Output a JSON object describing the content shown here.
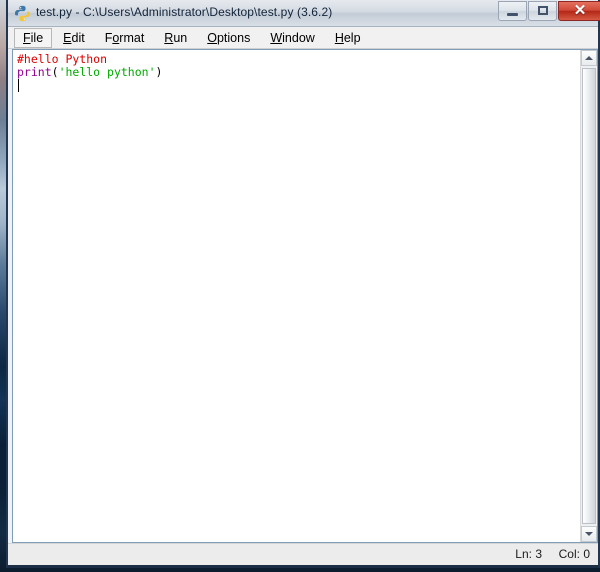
{
  "window": {
    "title": "test.py - C:\\Users\\Administrator\\Desktop\\test.py (3.6.2)",
    "icon": "python-idle-icon",
    "controls": {
      "minimize_label": "—",
      "maximize_label": "□",
      "close_label": "✕"
    }
  },
  "menubar": {
    "items": [
      {
        "label": "File",
        "pre": "",
        "accel": "F",
        "post": "ile",
        "name": "menu-file"
      },
      {
        "label": "Edit",
        "pre": "",
        "accel": "E",
        "post": "dit",
        "name": "menu-edit"
      },
      {
        "label": "Format",
        "pre": "F",
        "accel": "o",
        "post": "rmat",
        "name": "menu-format"
      },
      {
        "label": "Run",
        "pre": "",
        "accel": "R",
        "post": "un",
        "name": "menu-run"
      },
      {
        "label": "Options",
        "pre": "",
        "accel": "O",
        "post": "ptions",
        "name": "menu-options"
      },
      {
        "label": "Window",
        "pre": "",
        "accel": "W",
        "post": "indow",
        "name": "menu-window"
      },
      {
        "label": "Help",
        "pre": "",
        "accel": "H",
        "post": "elp",
        "name": "menu-help"
      }
    ]
  },
  "editor": {
    "lines": [
      {
        "number": 1,
        "tokens": [
          {
            "text": "#hello Python",
            "type": "comment"
          }
        ]
      },
      {
        "number": 2,
        "tokens": [
          {
            "text": "print",
            "type": "builtin"
          },
          {
            "text": "(",
            "type": "plain"
          },
          {
            "text": "'hello python'",
            "type": "string"
          },
          {
            "text": ")",
            "type": "plain"
          }
        ]
      },
      {
        "number": 3,
        "tokens": [
          {
            "text": "",
            "type": "plain"
          }
        ]
      }
    ],
    "caret_line": 3,
    "caret_col": 0,
    "colors": {
      "comment": "#dd0000",
      "builtin": "#900090",
      "string": "#00aa00",
      "plain": "#000000",
      "background": "#ffffff"
    }
  },
  "scrollbar": {
    "up_arrow": "scroll-up-arrow",
    "down_arrow": "scroll-down-arrow",
    "thumb": "scroll-thumb"
  },
  "statusbar": {
    "line_label": "Ln: 3",
    "col_label": "Col: 0"
  }
}
